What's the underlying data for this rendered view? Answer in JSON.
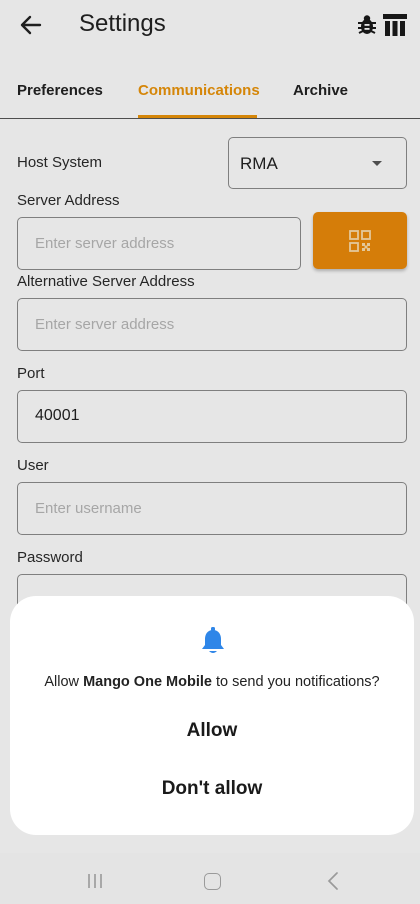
{
  "header": {
    "title": "Settings"
  },
  "tabs": [
    {
      "label": "Preferences"
    },
    {
      "label": "Communications",
      "active": true
    },
    {
      "label": "Archive"
    }
  ],
  "form": {
    "host_system": {
      "label": "Host System",
      "value": "RMA"
    },
    "server_address": {
      "label": "Server Address",
      "placeholder": "Enter server address"
    },
    "alt_server_address": {
      "label": "Alternative Server Address",
      "placeholder": "Enter server address"
    },
    "port": {
      "label": "Port",
      "value": "40001"
    },
    "user": {
      "label": "User",
      "placeholder": "Enter username"
    },
    "password": {
      "label": "Password"
    }
  },
  "dialog": {
    "prompt_prefix": "Allow ",
    "app_name": "Mango One Mobile",
    "prompt_suffix": " to send you notifications?",
    "allow_label": "Allow",
    "deny_label": "Don't allow"
  },
  "colors": {
    "accent": "#e8920a",
    "button": "#e8880a",
    "bell": "#2f86e8"
  },
  "icons": [
    "back-arrow-icon",
    "bug-icon",
    "brand-logo-icon",
    "qr-code-icon",
    "dropdown-caret-icon",
    "bell-icon",
    "recent-apps-icon",
    "home-icon",
    "nav-back-icon"
  ]
}
